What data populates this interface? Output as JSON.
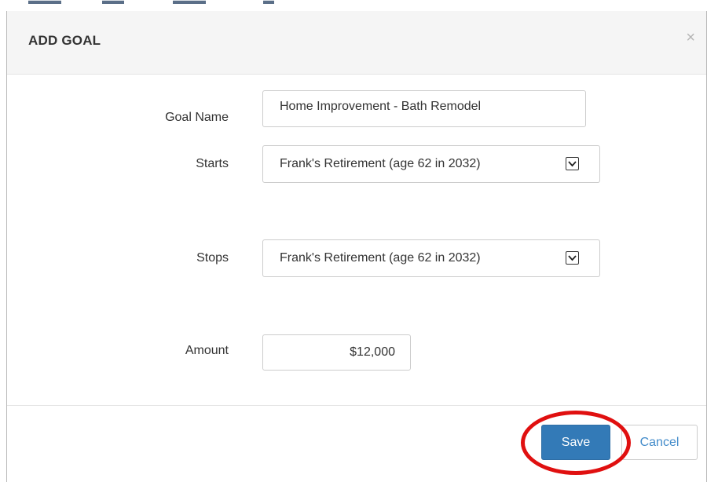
{
  "modal": {
    "title": "ADD GOAL",
    "close_glyph": "×"
  },
  "form": {
    "goal_name": {
      "label": "Goal Name",
      "value": "Home Improvement - Bath Remodel"
    },
    "starts": {
      "label": "Starts",
      "value": "Frank's Retirement (age 62 in 2032)"
    },
    "stops": {
      "label": "Stops",
      "value": "Frank's Retirement (age 62 in 2032)"
    },
    "amount": {
      "label": "Amount",
      "value": "$12,000"
    }
  },
  "footer": {
    "save_label": "Save",
    "cancel_label": "Cancel"
  },
  "colors": {
    "primary": "#337ab7",
    "link": "#428bca",
    "highlight": "#e01010"
  }
}
